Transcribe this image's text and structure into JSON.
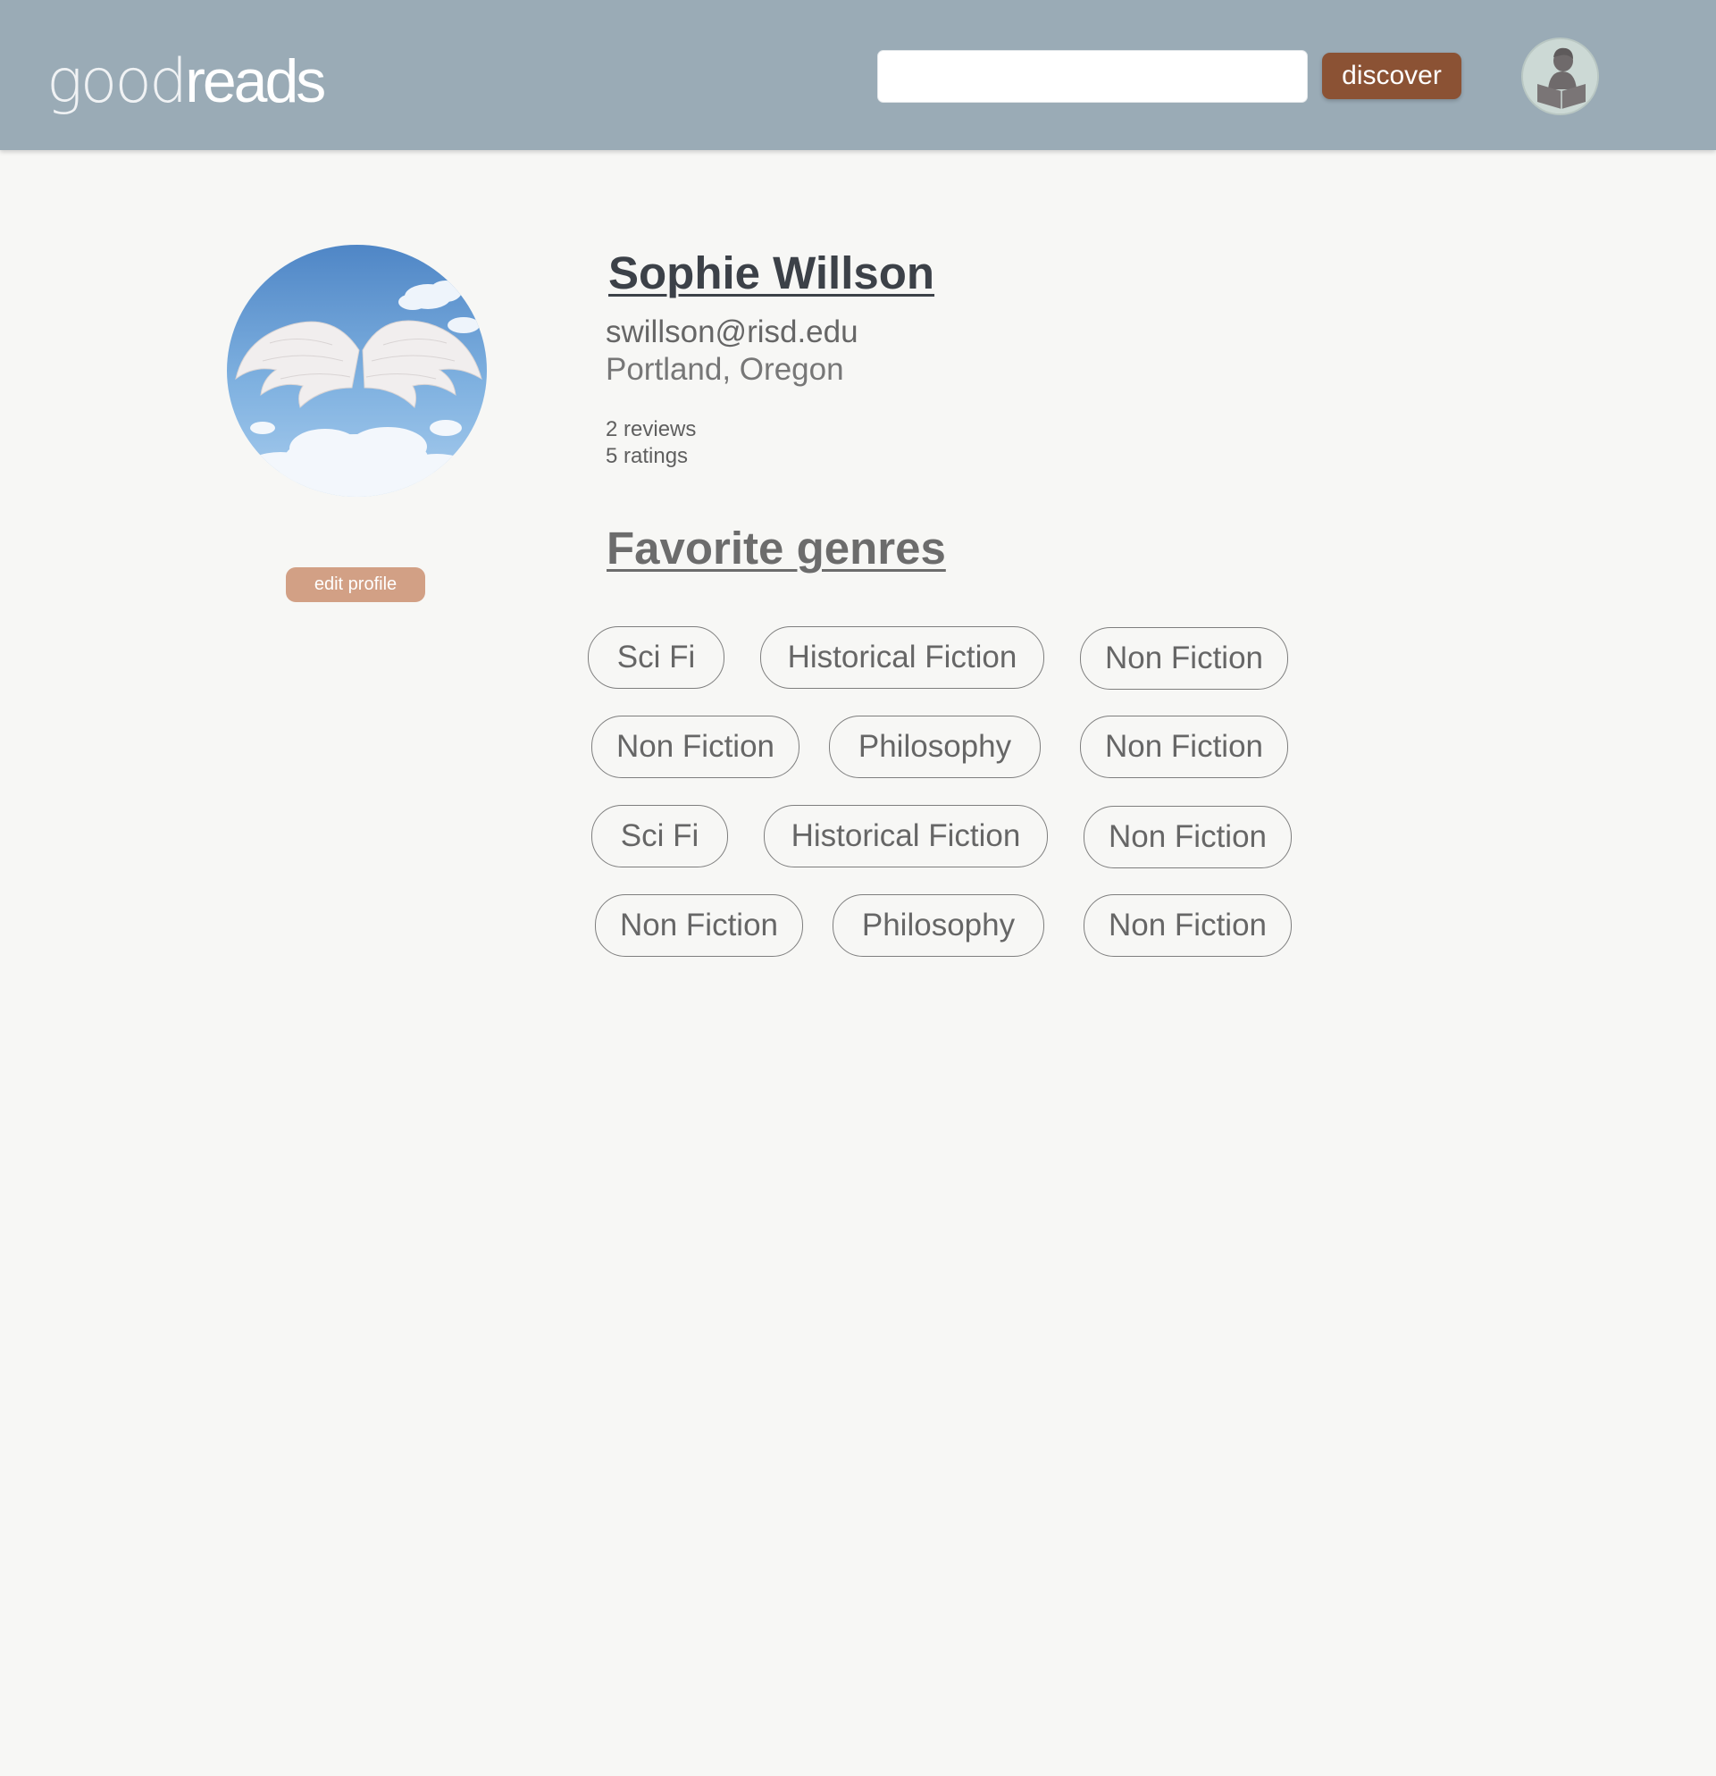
{
  "header": {
    "logo_light": "good",
    "logo_bold": "reads",
    "search": {
      "value": "",
      "placeholder": ""
    },
    "discover_label": "discover",
    "avatar_icon": "reader-icon"
  },
  "profile": {
    "photo": "angel-wings-clouds",
    "edit_label": "edit profile",
    "name": "Sophie Willson",
    "email": "swillson@risd.edu",
    "location": "Portland, Oregon",
    "reviews": "2 reviews",
    "ratings": "5 ratings"
  },
  "genres": {
    "heading": "Favorite genres",
    "chips": [
      "Sci Fi",
      "Historical Fiction",
      "Non Fiction",
      "Non Fiction",
      "Philosophy",
      "Non Fiction",
      "Sci Fi",
      "Historical Fiction",
      "Non Fiction",
      "Non Fiction",
      "Philosophy",
      "Non Fiction"
    ]
  },
  "colors": {
    "header_bg": "#9aabb6",
    "discover_bg": "#8b5234",
    "edit_bg": "#d2a085",
    "page_bg": "#f7f7f5"
  }
}
